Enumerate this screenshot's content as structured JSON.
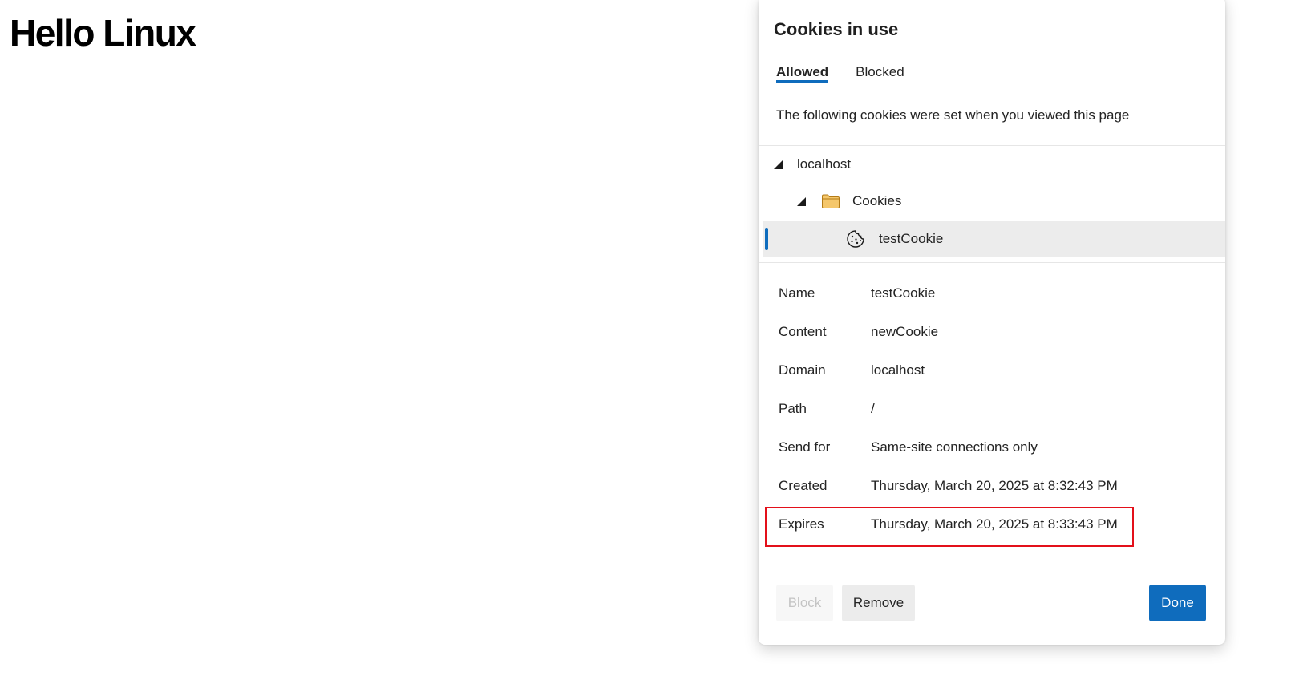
{
  "page": {
    "heading": "Hello Linux"
  },
  "dialog": {
    "title": "Cookies in use",
    "tabs": [
      {
        "label": "Allowed",
        "active": true
      },
      {
        "label": "Blocked",
        "active": false
      }
    ],
    "description": "The following cookies were set when you viewed this page",
    "tree": {
      "site": "localhost",
      "folder": "Cookies",
      "cookie": "testCookie"
    },
    "details": [
      {
        "label": "Name",
        "value": "testCookie"
      },
      {
        "label": "Content",
        "value": "newCookie"
      },
      {
        "label": "Domain",
        "value": "localhost"
      },
      {
        "label": "Path",
        "value": "/"
      },
      {
        "label": "Send for",
        "value": "Same-site connections only"
      },
      {
        "label": "Created",
        "value": "Thursday, March 20, 2025 at 8:32:43 PM"
      },
      {
        "label": "Expires",
        "value": "Thursday, March 20, 2025 at 8:33:43 PM"
      }
    ],
    "buttons": {
      "block": "Block",
      "remove": "Remove",
      "done": "Done"
    }
  },
  "colors": {
    "accent": "#0f6cbd",
    "highlight": "#e3101a",
    "folder": "#f5c76b"
  },
  "icons": {
    "expand": "caret-down-icon",
    "folder": "folder-icon",
    "cookie": "cookie-icon"
  }
}
